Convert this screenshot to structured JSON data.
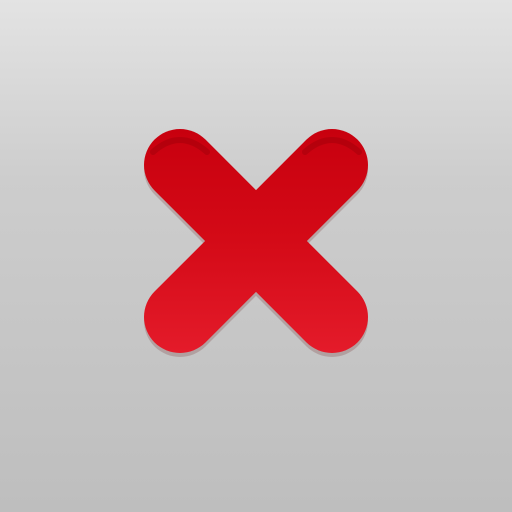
{
  "icon": {
    "name": "close-icon",
    "colors": {
      "background_top": "#e3e3e3",
      "background_bottom": "#bebebe",
      "cross_top": "#c8000e",
      "cross_mid": "#d40a17",
      "cross_bottom": "#e41b2a",
      "cross_shadow": "#9a0008"
    }
  }
}
